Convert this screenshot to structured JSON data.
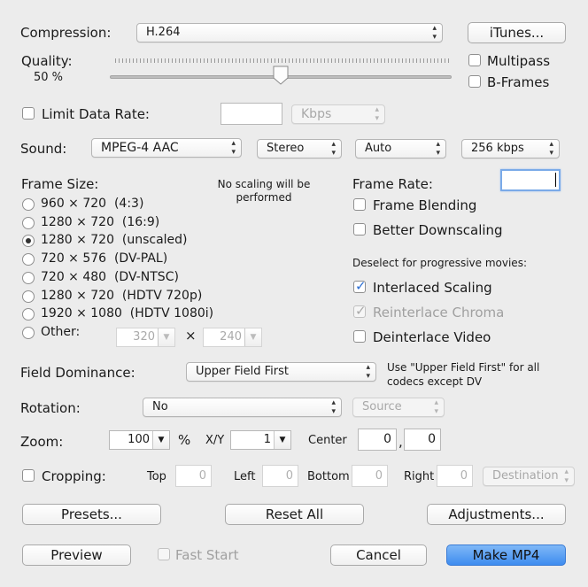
{
  "compression": {
    "label": "Compression:",
    "value": "H.264"
  },
  "itunes_button": "iTunes...",
  "quality": {
    "label": "Quality:",
    "value": "50 %",
    "fraction": 0.5
  },
  "multipass": {
    "label": "Multipass",
    "checked": false
  },
  "bframes": {
    "label": "B-Frames",
    "checked": false
  },
  "limit_data_rate": {
    "label": "Limit Data Rate:",
    "value": "",
    "unit": "Kbps"
  },
  "sound": {
    "label": "Sound:",
    "codec": "MPEG-4 AAC",
    "channels": "Stereo",
    "rate": "Auto",
    "bitrate": "256 kbps"
  },
  "frame_size": {
    "label": "Frame Size:",
    "note": "No scaling will be performed",
    "options": [
      "960 × 720  (4:3)",
      "1280 × 720  (16:9)",
      "1280 × 720  (unscaled)",
      "720 × 576  (DV-PAL)",
      "720 × 480  (DV-NTSC)",
      "1280 × 720  (HDTV 720p)",
      "1920 × 1080  (HDTV 1080i)",
      "Other:"
    ],
    "selected_index": 2,
    "other_width": "320",
    "other_times": "×",
    "other_height": "240"
  },
  "frame_rate": {
    "label": "Frame Rate:",
    "value": ""
  },
  "frame_blending": "Frame Blending",
  "better_downscaling": "Better Downscaling",
  "deselect_note": "Deselect for progressive movies:",
  "interlaced_scaling": "Interlaced Scaling",
  "reinterlace_chroma": "Reinterlace Chroma",
  "deinterlace_video": "Deinterlace Video",
  "field_dominance": {
    "label": "Field Dominance:",
    "value": "Upper Field First",
    "note": "Use \"Upper Field First\" for all codecs except DV"
  },
  "rotation": {
    "label": "Rotation:",
    "value": "No",
    "source": "Source"
  },
  "zoom": {
    "label": "Zoom:",
    "value": "100",
    "unit": "%",
    "xy_label": "X/Y",
    "xy_value": "1",
    "center_label": "Center",
    "center_x": "0",
    "center_comma": ",",
    "center_y": "0"
  },
  "cropping": {
    "label": "Cropping:",
    "top_label": "Top",
    "top": "0",
    "left_label": "Left",
    "left": "0",
    "bottom_label": "Bottom",
    "bottom": "0",
    "right_label": "Right",
    "right": "0",
    "destination": "Destination"
  },
  "buttons": {
    "presets": "Presets...",
    "reset_all": "Reset All",
    "adjustments": "Adjustments...",
    "preview": "Preview",
    "fast_start": "Fast Start",
    "cancel": "Cancel",
    "make": "Make MP4"
  }
}
